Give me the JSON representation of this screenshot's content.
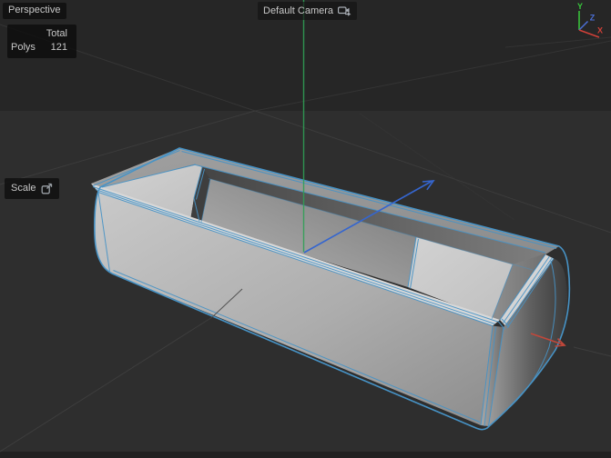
{
  "viewport": {
    "view_label": "Perspective",
    "camera_label": "Default Camera",
    "tool_label": "Scale",
    "hud": {
      "total_header": "Total",
      "rows": [
        {
          "label": "Polys",
          "value": "121"
        }
      ]
    }
  },
  "gizmo": {
    "x_label": "X",
    "y_label": "Y",
    "z_label": "Z"
  },
  "colors": {
    "background_top": "#262626",
    "background_bottom": "#2e2e2e",
    "bottom_strip": "#212121",
    "grid_line": "#3c3c3c",
    "selection_wireframe": "#4793c6",
    "axis_x": "#c2473a",
    "axis_y": "#2fa055",
    "axis_z": "#3566cf",
    "gizmo_x": "#d04038",
    "gizmo_y": "#38c93c",
    "gizmo_z": "#4b6fd6",
    "hud_text": "#c8c8c8"
  }
}
